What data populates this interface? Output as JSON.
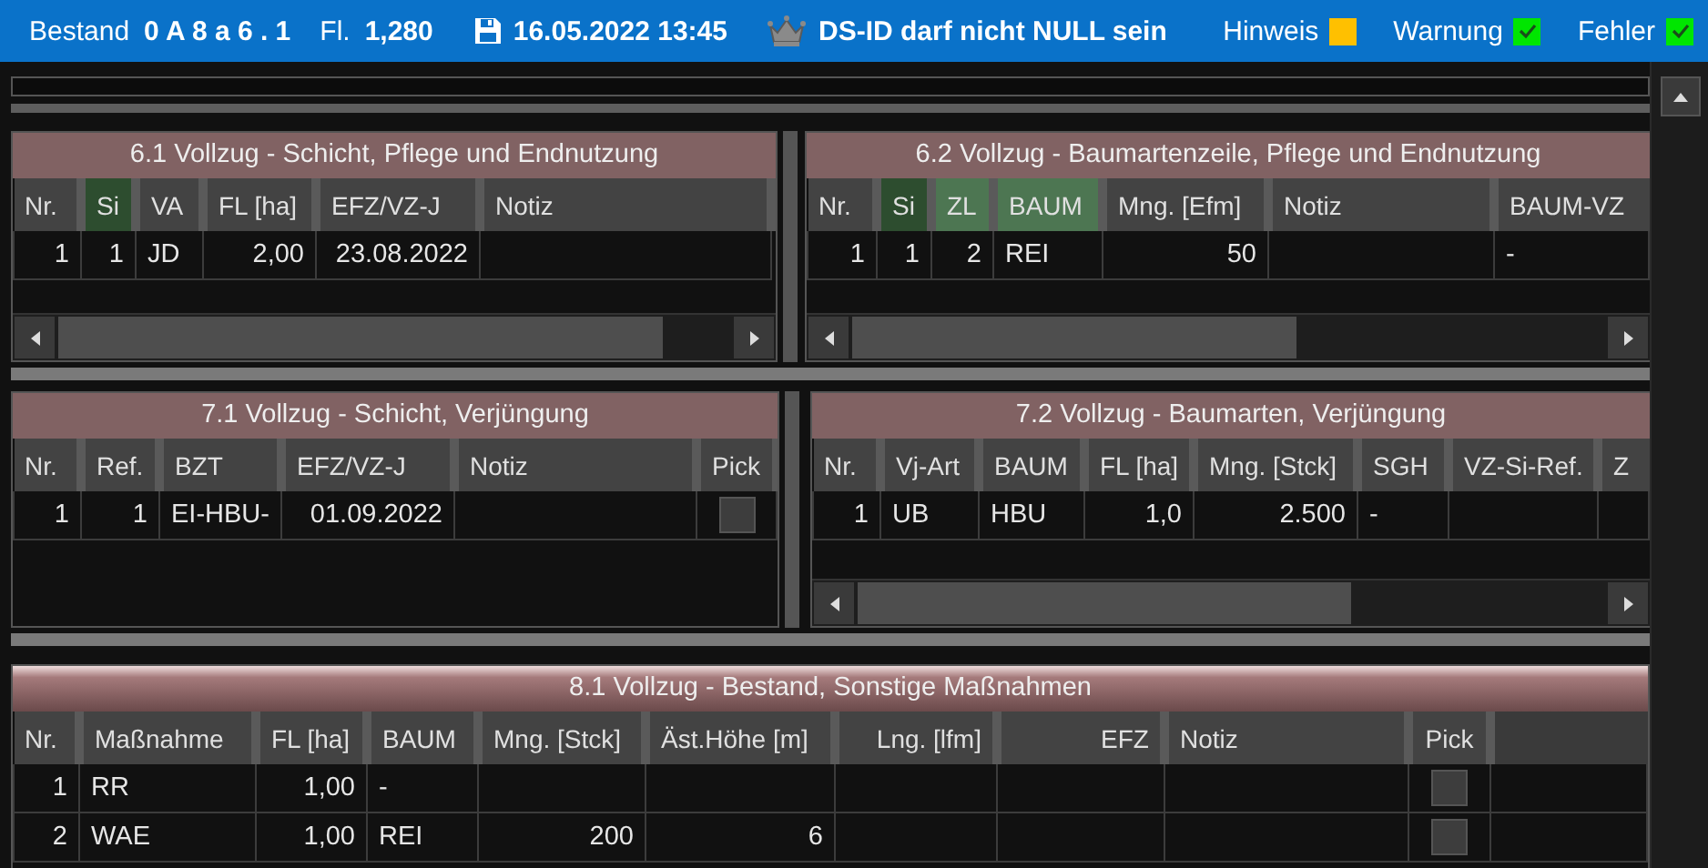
{
  "status_bar": {
    "stand_label": "Bestand",
    "stand_value": "0 A 8 a 6 . 1",
    "area_label": "Fl.",
    "area_value": "1,280",
    "saved": "16.05.2022 13:45",
    "message": "DS-ID darf nicht NULL sein",
    "legend": [
      {
        "label": "Hinweis",
        "color": "#ffc000",
        "checked": false
      },
      {
        "label": "Warnung",
        "color": "#00e600",
        "checked": true
      },
      {
        "label": "Fehler",
        "color": "#00e600",
        "checked": true
      }
    ]
  },
  "panel_rows": [
    [
      {
        "title": "6.1 Vollzug - Schicht, Pflege und Endnutzung",
        "scrollbar": true,
        "columns": [
          {
            "label": "Nr."
          },
          {
            "label": "Si",
            "color": "#2d4d2f"
          },
          {
            "label": "VA"
          },
          {
            "label": "FL [ha]"
          },
          {
            "label": "EFZ/VZ-J"
          },
          {
            "label": "Notiz"
          }
        ],
        "rows": [
          [
            "1",
            "1",
            "JD",
            "2,00",
            "23.08.2022",
            null
          ]
        ]
      },
      {
        "title": "6.2 Vollzug - Baumartenzeile, Pflege und Endnutzung",
        "scrollbar": true,
        "columns": [
          {
            "label": "Nr."
          },
          {
            "label": "Si",
            "color": "#2d4d2f"
          },
          {
            "label": "ZL",
            "color": "#4d7652"
          },
          {
            "label": "BAUM",
            "color": "#4d7652"
          },
          {
            "label": "Mng. [Efm]"
          },
          {
            "label": "Notiz"
          },
          {
            "label": "BAUM-VZ"
          }
        ],
        "rows": [
          [
            "1",
            "1",
            "2",
            "REI",
            "50",
            null,
            "-"
          ]
        ]
      }
    ],
    [
      {
        "title": "7.1 Vollzug - Schicht, Verjüngung",
        "scrollbar": false,
        "columns": [
          {
            "label": "Nr."
          },
          {
            "label": "Ref."
          },
          {
            "label": "BZT"
          },
          {
            "label": "EFZ/VZ-J"
          },
          {
            "label": "Notiz"
          },
          {
            "label": "Pick"
          }
        ],
        "rows": [
          [
            "1",
            "1",
            "EI-HBU-",
            "01.09.2022",
            null,
            {
              "kind": "checkbox",
              "checked": false
            }
          ]
        ]
      },
      {
        "title": "7.2 Vollzug - Baumarten, Verjüngung",
        "scrollbar": true,
        "columns": [
          {
            "label": "Nr."
          },
          {
            "label": "Vj-Art"
          },
          {
            "label": "BAUM"
          },
          {
            "label": "FL [ha]"
          },
          {
            "label": "Mng. [Stck]"
          },
          {
            "label": "SGH"
          },
          {
            "label": "VZ-Si-Ref."
          },
          {
            "label": "Z"
          }
        ],
        "rows": [
          [
            "1",
            "UB",
            "HBU",
            "1,0",
            "2.500",
            "-",
            null,
            null
          ]
        ]
      }
    ]
  ],
  "bottom_panel": {
    "title": "8.1 Vollzug - Bestand, Sonstige Maßnahmen",
    "scrollbar": false,
    "columns": [
      {
        "label": "Nr."
      },
      {
        "label": "Maßnahme"
      },
      {
        "label": "FL [ha]"
      },
      {
        "label": "BAUM"
      },
      {
        "label": "Mng. [Stck]"
      },
      {
        "label": "Äst.Höhe [m]"
      },
      {
        "label": "Lng. [lfm]"
      },
      {
        "label": "EFZ"
      },
      {
        "label": "Notiz"
      },
      {
        "label": "Pick"
      }
    ],
    "rows": [
      [
        "1",
        "RR",
        "1,00",
        "-",
        null,
        null,
        null,
        null,
        null,
        {
          "kind": "checkbox",
          "checked": false
        }
      ],
      [
        "2",
        "WAE",
        "1,00",
        "REI",
        "200",
        "6",
        null,
        null,
        null,
        {
          "kind": "checkbox",
          "checked": false
        }
      ]
    ]
  }
}
